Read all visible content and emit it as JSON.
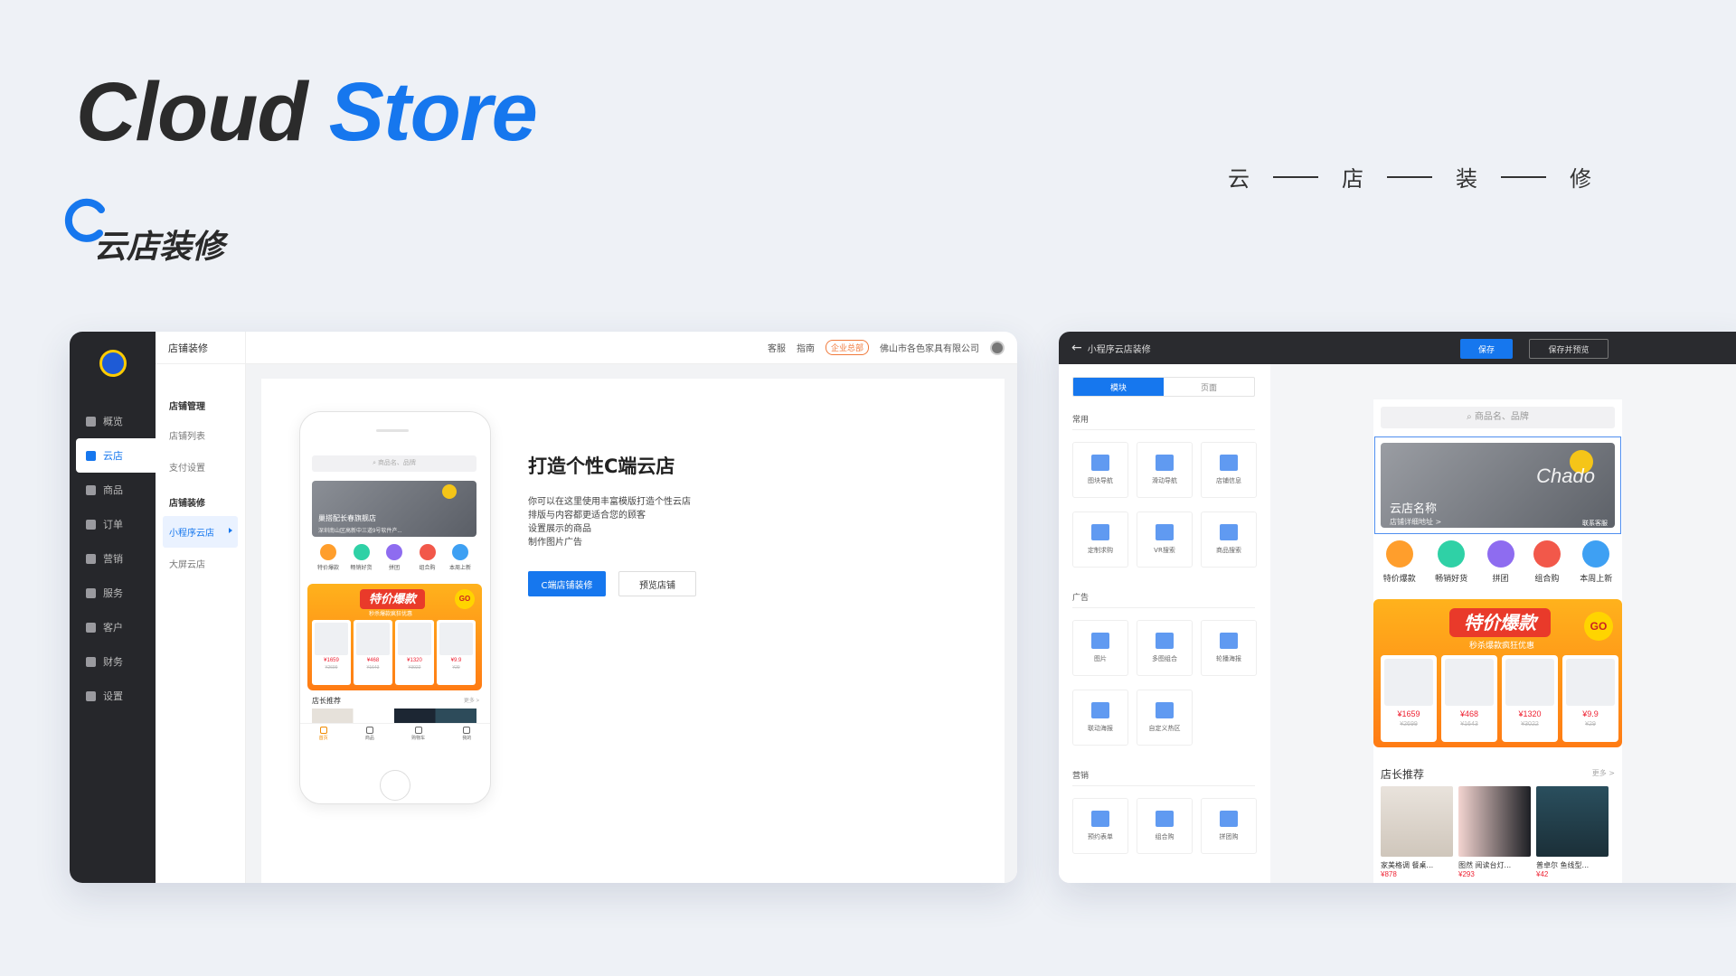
{
  "hero": {
    "title_part1": "Cloud",
    "title_part2": "Store",
    "logo_text": "云店装修"
  },
  "tagline": [
    "云",
    "店",
    "装",
    "修"
  ],
  "left_window": {
    "nav": [
      "概览",
      "云店",
      "商品",
      "订单",
      "营销",
      "服务",
      "客户",
      "财务",
      "设置"
    ],
    "topbar": {
      "title": "店铺装修",
      "service": "客服",
      "guide": "指南",
      "badge": "企业总部",
      "company": "佛山市各色家具有限公司"
    },
    "sub_nav": {
      "group1": "店铺管理",
      "items1": [
        "店铺列表",
        "支付设置"
      ],
      "group2": "店铺装修",
      "items2": [
        "小程序云店",
        "大屏云店"
      ]
    },
    "phone": {
      "search_placeholder": "商品名、品牌",
      "store_name": "巢搭配长春旗舰店",
      "store_addr": "深圳南山区高新中三道9号软件产...",
      "icons": [
        "特价爆款",
        "畅销好货",
        "拼团",
        "组合购",
        "本周上新"
      ],
      "promo_title": "特价爆款",
      "promo_sub": "秒杀爆款疯狂优惠",
      "promo_go": "GO",
      "products": [
        {
          "price": "¥1659",
          "old": "¥2699"
        },
        {
          "price": "¥468",
          "old": "¥1643"
        },
        {
          "price": "¥1320",
          "old": "¥3022"
        },
        {
          "price": "¥9.9",
          "old": "¥29"
        }
      ],
      "rec_title": "店长推荐",
      "rec_more": "更多 >",
      "tabs": [
        "首页",
        "商品",
        "购物车",
        "我的"
      ]
    },
    "intro": {
      "title": "打造个性C端云店",
      "lines": [
        "你可以在这里使用丰富模版打造个性云店",
        "排版与内容都更适合您的顾客",
        "设置展示的商品",
        "制作图片广告"
      ],
      "primary_button": "C端店铺装修",
      "secondary_button": "预览店铺"
    }
  },
  "right_window": {
    "title": "小程序云店装修",
    "save": "保存",
    "save_preview": "保存并预览",
    "tabs": [
      "模块",
      "页面"
    ],
    "groups": [
      {
        "name": "常用",
        "tiles": [
          "图块导航",
          "滑动导航",
          "店铺信息",
          "定制求购",
          "VR搜索",
          "商品搜索"
        ]
      },
      {
        "name": "广告",
        "tiles": [
          "图片",
          "多图组合",
          "轮播海报",
          "联动海报",
          "自定义热区"
        ]
      },
      {
        "name": "营销",
        "tiles": [
          "预约表单",
          "组合购",
          "拼团购"
        ]
      }
    ],
    "preview": {
      "search_placeholder": "商品名、品牌",
      "store_name": "云店名称",
      "store_addr": "店铺详细地址 >",
      "contact": "联系客服",
      "banner_word": "Chado",
      "icons": [
        "特价爆款",
        "畅销好货",
        "拼团",
        "组合购",
        "本周上新"
      ],
      "promo_title": "特价爆款",
      "promo_sub": "秒杀爆款疯狂优惠",
      "promo_go": "GO",
      "products": [
        {
          "price": "¥1659",
          "old": "¥2699"
        },
        {
          "price": "¥468",
          "old": "¥1643"
        },
        {
          "price": "¥1320",
          "old": "¥3022"
        },
        {
          "price": "¥9.9",
          "old": "¥29"
        }
      ],
      "rec_title": "店长推荐",
      "rec_more": "更多 >",
      "recs": [
        {
          "name": "家美格调 餐桌...",
          "price": "¥878"
        },
        {
          "name": "图然 阅读台灯...",
          "price": "¥293"
        },
        {
          "name": "普卓尔 鱼线型...",
          "price": "¥42"
        }
      ]
    }
  },
  "colors": {
    "accent": "#1677ee",
    "dark": "#26272b",
    "promo_orange": "#ff7b14"
  }
}
